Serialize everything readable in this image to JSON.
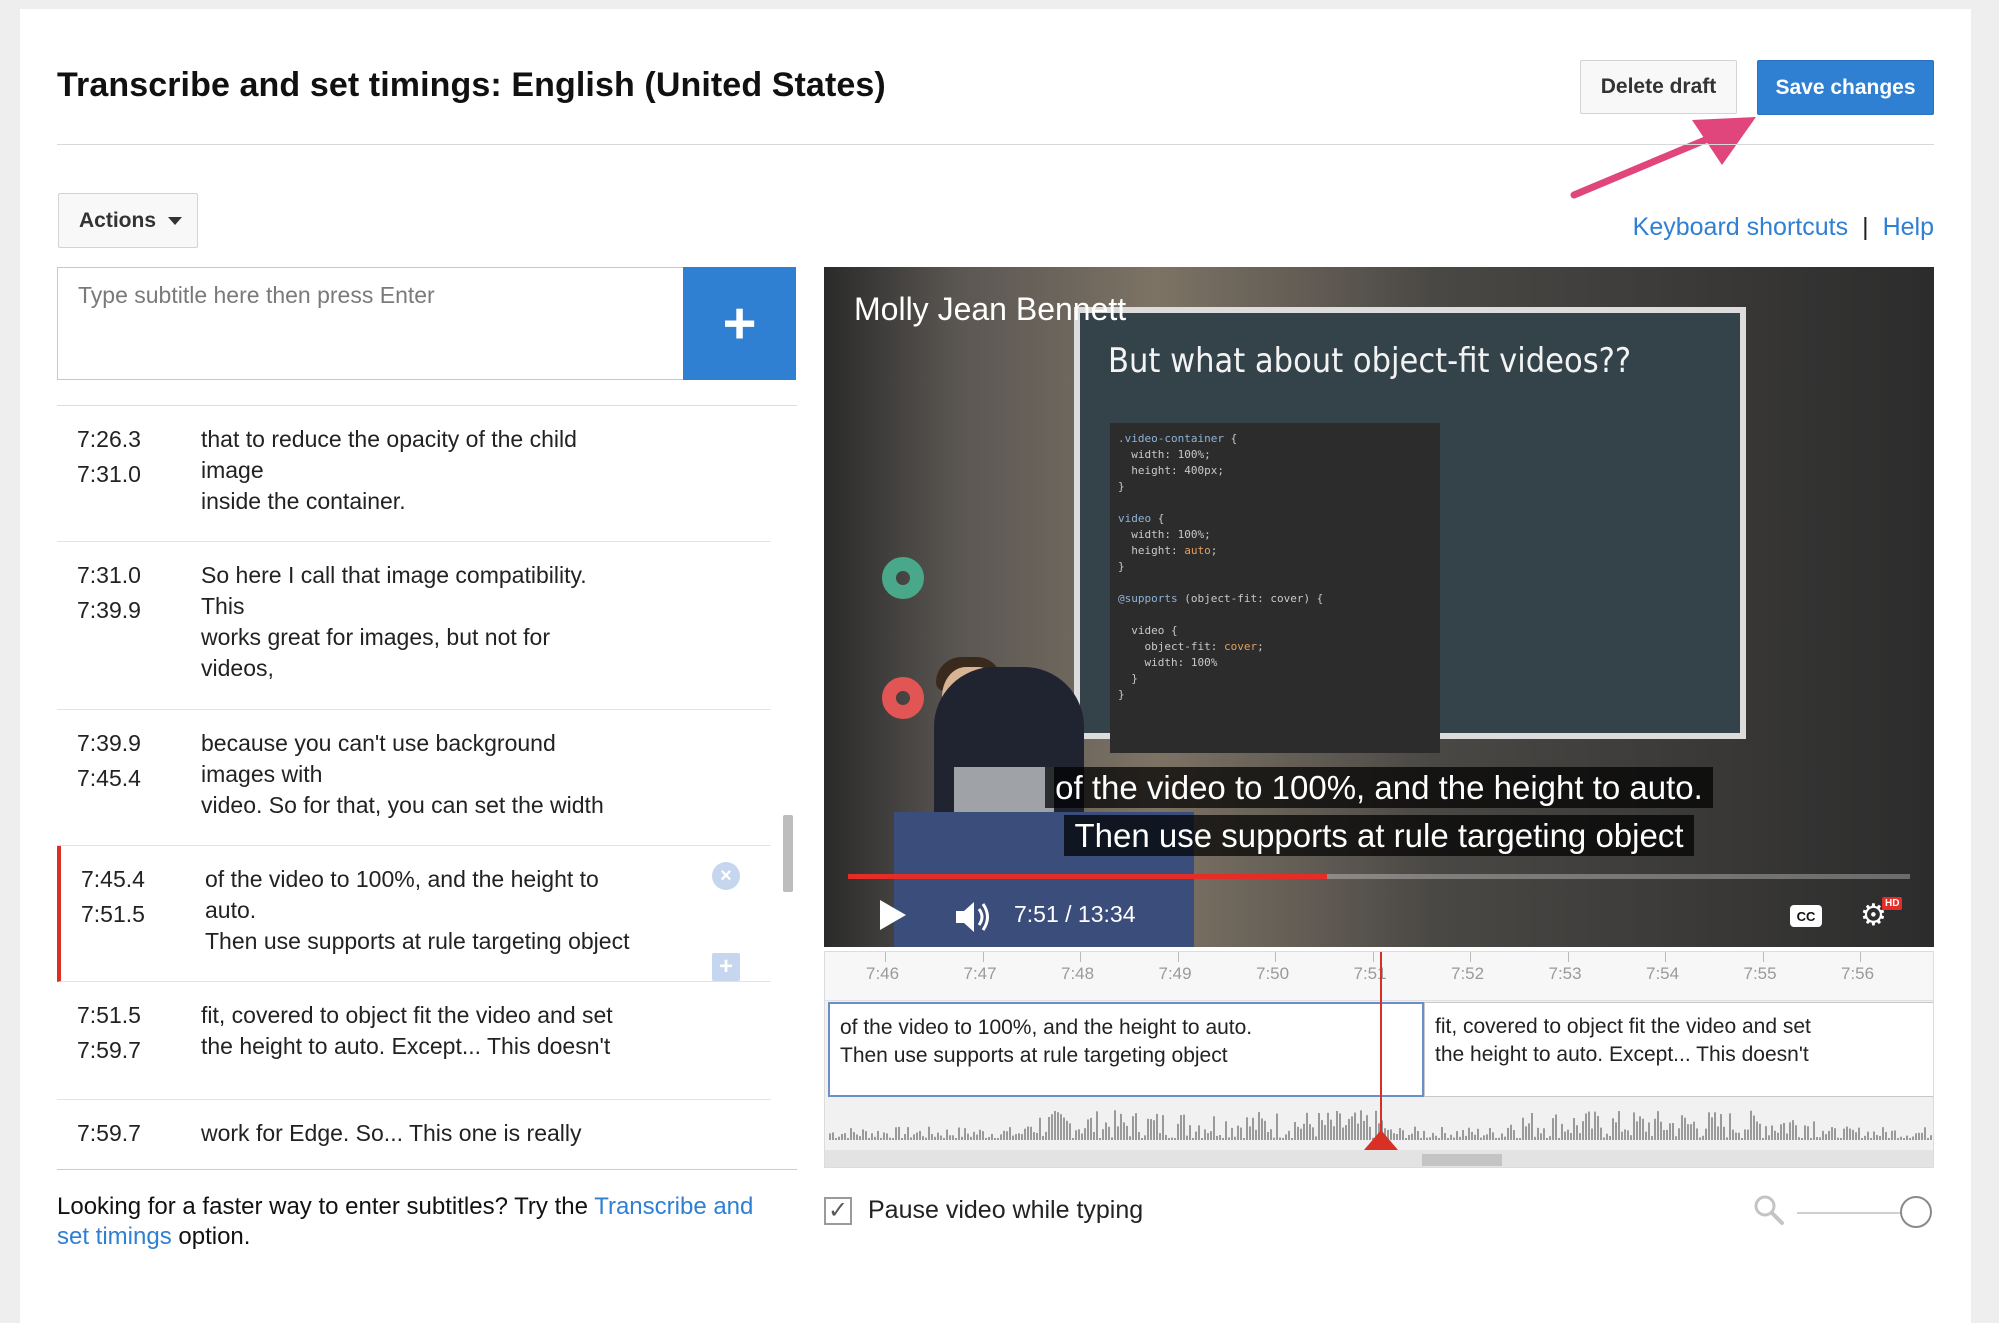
{
  "header": {
    "title": "Transcribe and set timings: English (United States)",
    "delete_label": "Delete draft",
    "save_label": "Save changes"
  },
  "toolbar": {
    "actions_label": "Actions",
    "keyboard_shortcuts": "Keyboard shortcuts",
    "separator": "|",
    "help": "Help"
  },
  "subtitle_input": {
    "placeholder": "Type subtitle here then press Enter",
    "add_icon": "+"
  },
  "subtitle_list": [
    {
      "start": "7:26.3",
      "end": "7:31.0",
      "lines": [
        "that to reduce the opacity of the child",
        "image",
        "inside the container."
      ],
      "active": false
    },
    {
      "start": "7:31.0",
      "end": "7:39.9",
      "lines": [
        "So here I call that image compatibility.",
        "This",
        "works great for images, but not for",
        "videos,"
      ],
      "active": false
    },
    {
      "start": "7:39.9",
      "end": "7:45.4",
      "lines": [
        "because you can't use background",
        "images with",
        "video. So for that, you can set the width"
      ],
      "active": false
    },
    {
      "start": "7:45.4",
      "end": "7:51.5",
      "lines": [
        "of the video to 100%, and the height to",
        "auto.",
        "Then use supports at rule targeting object"
      ],
      "active": true
    },
    {
      "start": "7:51.5",
      "end": "7:59.7",
      "lines": [
        "fit, covered to object fit the video and set",
        "the height to auto. Except... This doesn't"
      ],
      "active": false
    },
    {
      "start": "7:59.7",
      "end": "",
      "lines": [
        "work for Edge. So... This one is really"
      ],
      "active": false
    }
  ],
  "footnote": {
    "prefix": "Looking for a faster way to enter subtitles? Try the ",
    "link": "Transcribe and set timings",
    "suffix": " option."
  },
  "video": {
    "channel_name": "Molly Jean Bennett",
    "slide_title": "But what about object-fit videos??",
    "caption_line1": "of the video to 100%, and the height to auto.",
    "caption_line2": "Then use supports at rule targeting object",
    "time_readout": "7:51 / 13:34",
    "progress": 0.451,
    "cc_label": "CC",
    "hd_label": "HD",
    "icons": [
      "play-icon",
      "volume-icon",
      "captions-icon",
      "settings-icon"
    ]
  },
  "timeline": {
    "ticks": [
      "7:46",
      "7:47",
      "7:48",
      "7:49",
      "7:50",
      "7:51",
      "7:52",
      "7:53",
      "7:54",
      "7:55",
      "7:56"
    ],
    "segments": [
      {
        "text_line1": "of the video to 100%, and the height to auto.",
        "text_line2": "Then use supports at rule targeting object"
      },
      {
        "text_line1": "fit, covered to object fit the video and set",
        "text_line2": "the height to auto. Except... This doesn't"
      }
    ]
  },
  "options": {
    "pause_label": "Pause video while typing",
    "pause_checked": true,
    "zoom_icon": "search-icon",
    "zoom_level": 1.0
  },
  "colors": {
    "accent": "#2f7fd3",
    "active_marker": "#d93025",
    "arrow": "#e0457b"
  }
}
